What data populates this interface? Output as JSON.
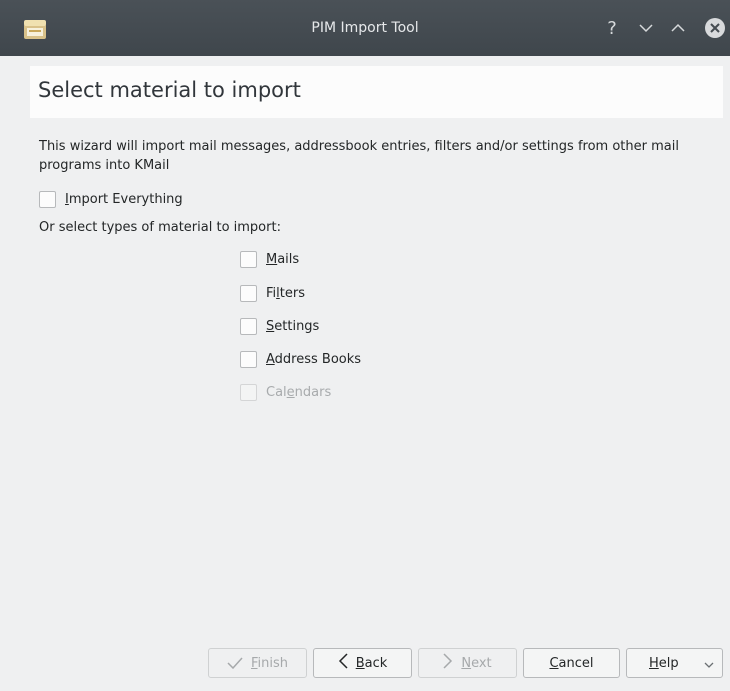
{
  "window": {
    "title": "PIM Import Tool"
  },
  "header": {
    "title": "Select material to import"
  },
  "description": "This wizard will import mail messages, addressbook entries, filters and/or settings from other mail programs into KMail",
  "import_everything": {
    "label_first": "I",
    "label_rest": "mport Everything"
  },
  "or_label": "Or select types of material to import:",
  "types": [
    {
      "pre": "",
      "u": "M",
      "post": "ails"
    },
    {
      "pre": "Fi",
      "u": "l",
      "post": "ters"
    },
    {
      "pre": "",
      "u": "S",
      "post": "ettings"
    },
    {
      "pre": "",
      "u": "A",
      "post": "ddress Books"
    },
    {
      "pre": "Cal",
      "u": "e",
      "post": "ndars"
    }
  ],
  "buttons": {
    "finish": {
      "u": "F",
      "post": "inish"
    },
    "back": {
      "u": "B",
      "post": "ack"
    },
    "next": {
      "u": "N",
      "post": "ext"
    },
    "cancel": {
      "u": "C",
      "post": "ancel"
    },
    "help": {
      "u": "H",
      "post": "elp"
    }
  },
  "icons": {
    "app": "mailbox-icon",
    "help": "help-icon",
    "minimize": "minimize-icon",
    "maximize": "maximize-icon",
    "close": "close-icon",
    "finish": "checkmark-icon",
    "back": "chevron-left-icon",
    "next": "chevron-right-icon",
    "help_menu": "chevron-down-icon"
  },
  "colors": {
    "titlebar": "#475057",
    "window": "#eff0f1",
    "header_panel": "#fcfcfc"
  }
}
